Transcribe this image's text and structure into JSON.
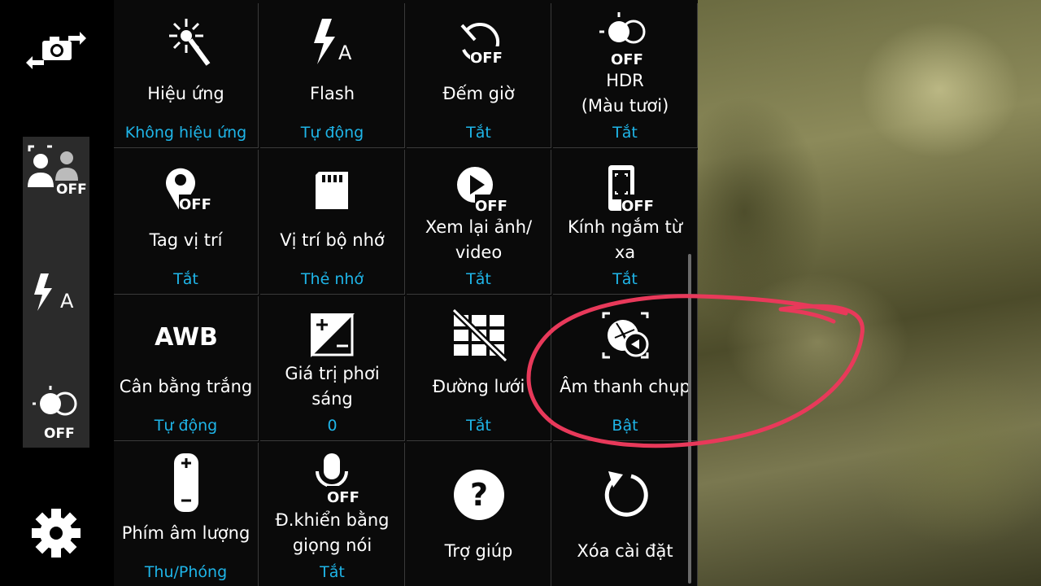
{
  "shortcuts": {
    "switch_camera_icon": "camera-switch-icon",
    "face_detect_off": "OFF",
    "flash_auto_letter": "A",
    "hdr_off": "OFF",
    "settings_icon": "gear-icon"
  },
  "settings": [
    {
      "icon": "effects-icon",
      "label": "Hiệu ứng",
      "value": "Không hiệu ứng"
    },
    {
      "icon": "flash-auto-icon",
      "label": "Flash",
      "value": "Tự động",
      "icon_text": "A"
    },
    {
      "icon": "timer-off-icon",
      "label": "Đếm giờ",
      "value": "Tắt",
      "icon_text": "OFF"
    },
    {
      "icon": "hdr-off-icon",
      "label_line1": "HDR",
      "label_line2": "(Màu tươi)",
      "value": "Tắt",
      "icon_text": "OFF"
    },
    {
      "icon": "location-tag-off-icon",
      "label": "Tag vị trí",
      "value": "Tắt",
      "icon_text": "OFF"
    },
    {
      "icon": "sd-card-icon",
      "label": "Vị trí bộ nhớ",
      "value": "Thẻ nhớ"
    },
    {
      "icon": "review-off-icon",
      "label_line1": "Xem lại ảnh/",
      "label_line2": "video",
      "value": "Tắt",
      "icon_text": "OFF"
    },
    {
      "icon": "remote-viewfinder-off-icon",
      "label_line1": "Kính ngắm từ",
      "label_line2": "xa",
      "value": "Tắt",
      "icon_text": "OFF"
    },
    {
      "icon": "awb-icon",
      "label": "Cân bằng trắng",
      "value": "Tự động",
      "icon_text": "AWB"
    },
    {
      "icon": "exposure-icon",
      "label_line1": "Giá trị phơi",
      "label_line2": "sáng",
      "value": "0"
    },
    {
      "icon": "grid-lines-off-icon",
      "label": "Đường lưới",
      "value": "Tắt"
    },
    {
      "icon": "shutter-sound-icon",
      "label": "Âm thanh chụp",
      "value": "Bật"
    },
    {
      "icon": "volume-key-icon",
      "label": "Phím âm lượng",
      "value": "Thu/Phóng"
    },
    {
      "icon": "voice-control-off-icon",
      "label_line1": "Đ.khiển bằng",
      "label_line2": "giọng nói",
      "value": "Tắt",
      "icon_text": "OFF"
    },
    {
      "icon": "help-icon",
      "label": "Trợ giúp",
      "icon_text": "?"
    },
    {
      "icon": "reset-icon",
      "label": "Xóa cài đặt"
    }
  ],
  "colors": {
    "value_text": "#1fb5e8",
    "annotation": "#e8395a",
    "panel_bg": "#0a0a0a"
  }
}
